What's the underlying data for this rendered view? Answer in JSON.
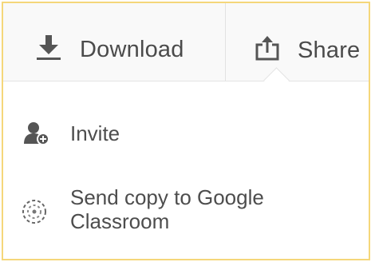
{
  "toolbar": {
    "download_label": "Download",
    "download_icon": "download-icon",
    "share_label": "Share",
    "share_icon": "share-icon",
    "active_tab": "Share"
  },
  "share_menu": {
    "items": [
      {
        "label": "Invite",
        "icon": "add-user-icon"
      },
      {
        "label": "Send copy to Google Classroom",
        "icon": "google-classroom-icon"
      }
    ]
  },
  "colors": {
    "frame_border": "#f5d77a",
    "toolbar_bg": "#f9f9f9",
    "text": "#4d4d4d",
    "icon": "#555555"
  }
}
